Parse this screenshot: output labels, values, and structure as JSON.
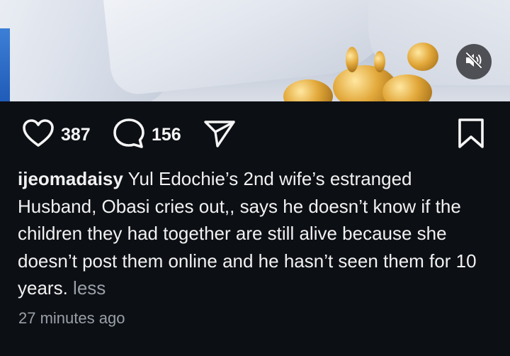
{
  "post": {
    "like_count": "387",
    "comment_count": "156",
    "username": "ijeomadaisy",
    "caption": "Yul Edochie’s 2nd wife’s estranged Husband, Obasi cries out,, says he doesn’t know if the children they had together are still alive because she doesn’t post them online and he hasn’t seen them for 10 years.",
    "less_label": "less",
    "timestamp": "27 minutes ago"
  },
  "icons": {
    "like": "heart-icon",
    "comment": "comment-bubble-icon",
    "share": "paper-plane-icon",
    "save": "bookmark-icon",
    "mute": "speaker-muted-icon"
  },
  "colors": {
    "background": "#0c0f14",
    "text": "#f1f1f1",
    "muted_text": "#9aa0a8"
  }
}
